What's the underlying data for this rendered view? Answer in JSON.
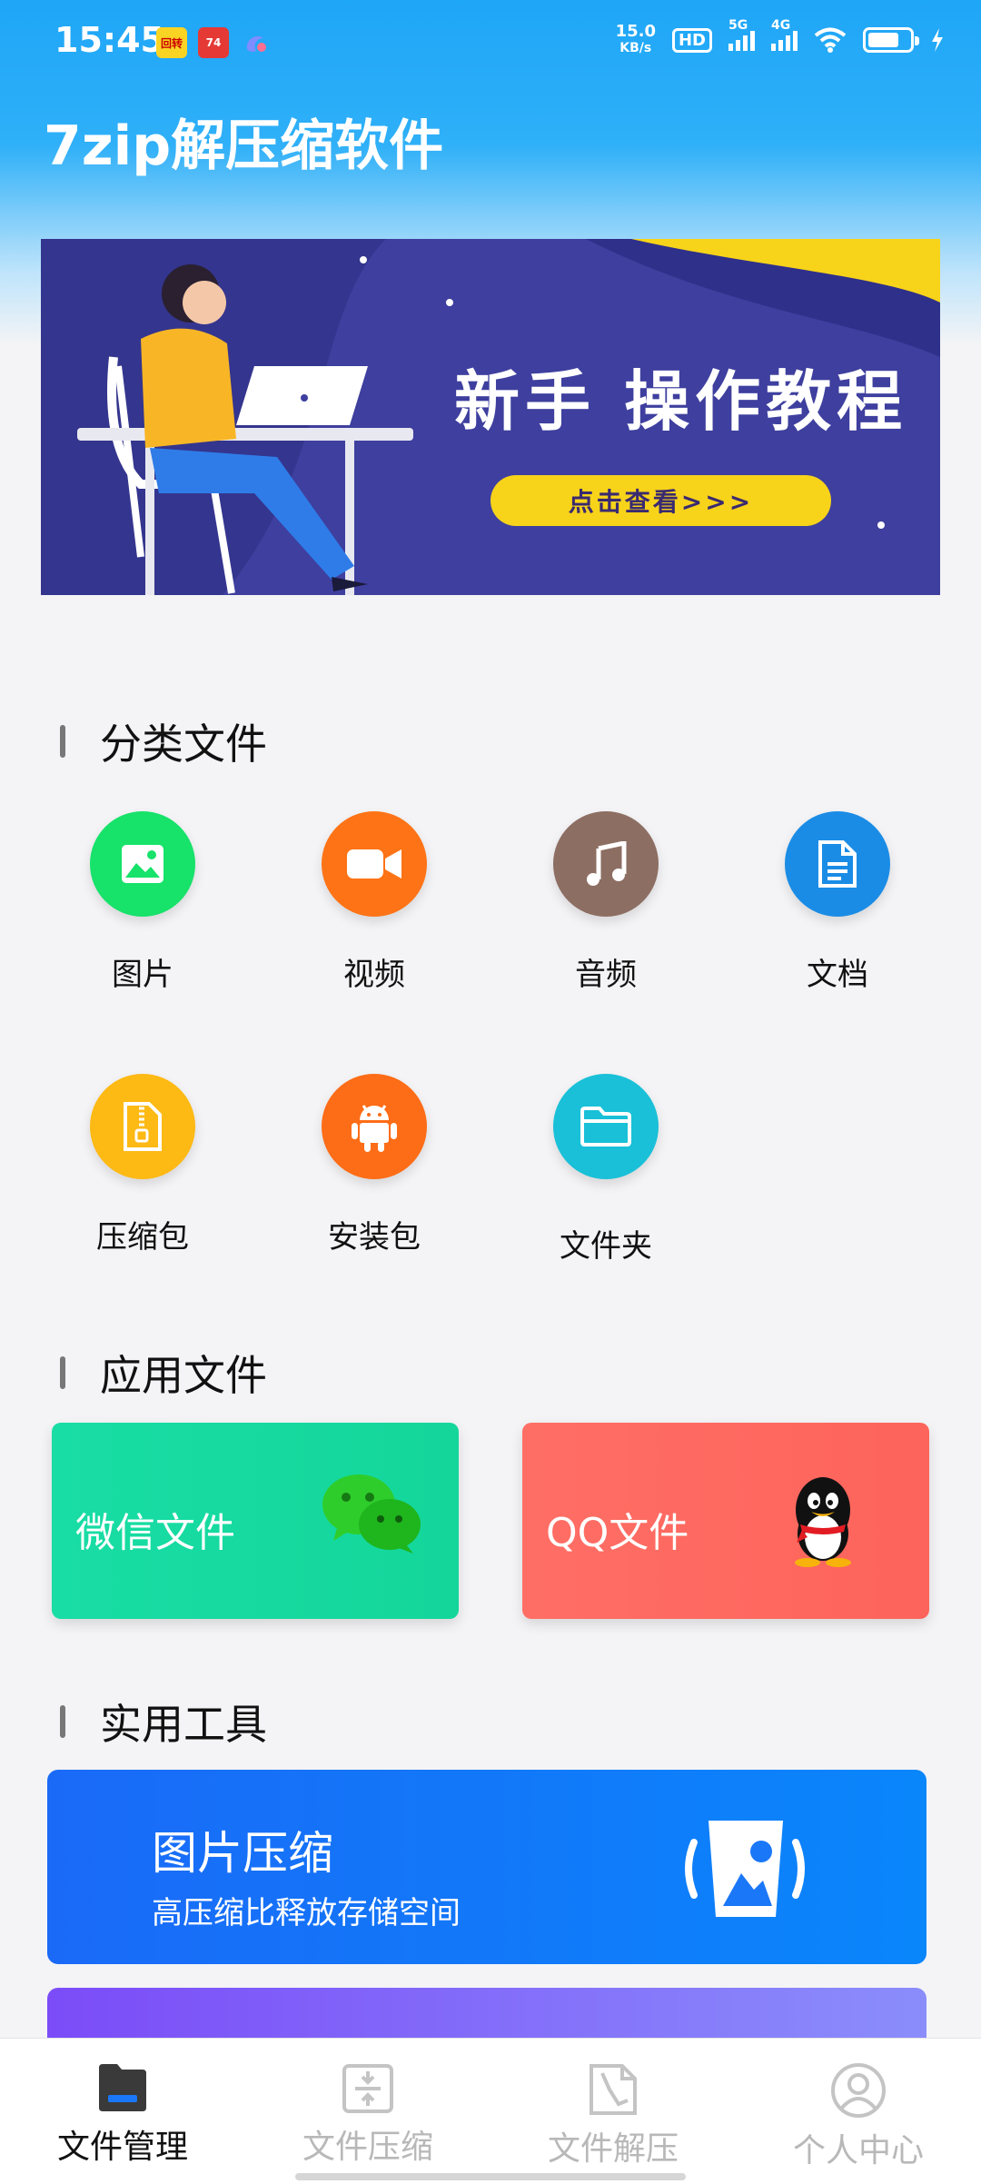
{
  "status": {
    "time": "15:45",
    "net_speed_value": "15.0",
    "net_speed_unit": "KB/s",
    "hd": "HD",
    "sig1": "5G",
    "sig2": "4G",
    "app_badge_1": "回转",
    "app_badge_2": "74"
  },
  "header": {
    "title": "7zip解压缩软件"
  },
  "banner": {
    "title": "新手 操作教程",
    "cta": "点击查看>>>"
  },
  "categories": {
    "title": "分类文件",
    "items": [
      {
        "label": "图片",
        "icon": "image-icon",
        "color": "#17e26a"
      },
      {
        "label": "视频",
        "icon": "video-icon",
        "color": "#fd7316"
      },
      {
        "label": "音频",
        "icon": "music-icon",
        "color": "#8d6e63"
      },
      {
        "label": "文档",
        "icon": "document-icon",
        "color": "#1a8ce6"
      },
      {
        "label": "压缩包",
        "icon": "zip-icon",
        "color": "#fdb914"
      },
      {
        "label": "安装包",
        "icon": "android-icon",
        "color": "#fd6c16"
      },
      {
        "label": "文件夹",
        "icon": "folder-icon",
        "color": "#19c0d8"
      }
    ]
  },
  "app_files": {
    "title": "应用文件",
    "wechat": {
      "label": "微信文件",
      "color": "#16dba2"
    },
    "qq": {
      "label": "QQ文件",
      "color": "#fd6b62"
    }
  },
  "tools": {
    "title": "实用工具",
    "items": [
      {
        "title": "图片压缩",
        "subtitle": "高压缩比释放存储空间"
      }
    ]
  },
  "nav": {
    "items": [
      {
        "label": "文件管理",
        "active": true
      },
      {
        "label": "文件压缩",
        "active": false
      },
      {
        "label": "文件解压",
        "active": false
      },
      {
        "label": "个人中心",
        "active": false
      }
    ]
  },
  "battery_level": 0.75
}
